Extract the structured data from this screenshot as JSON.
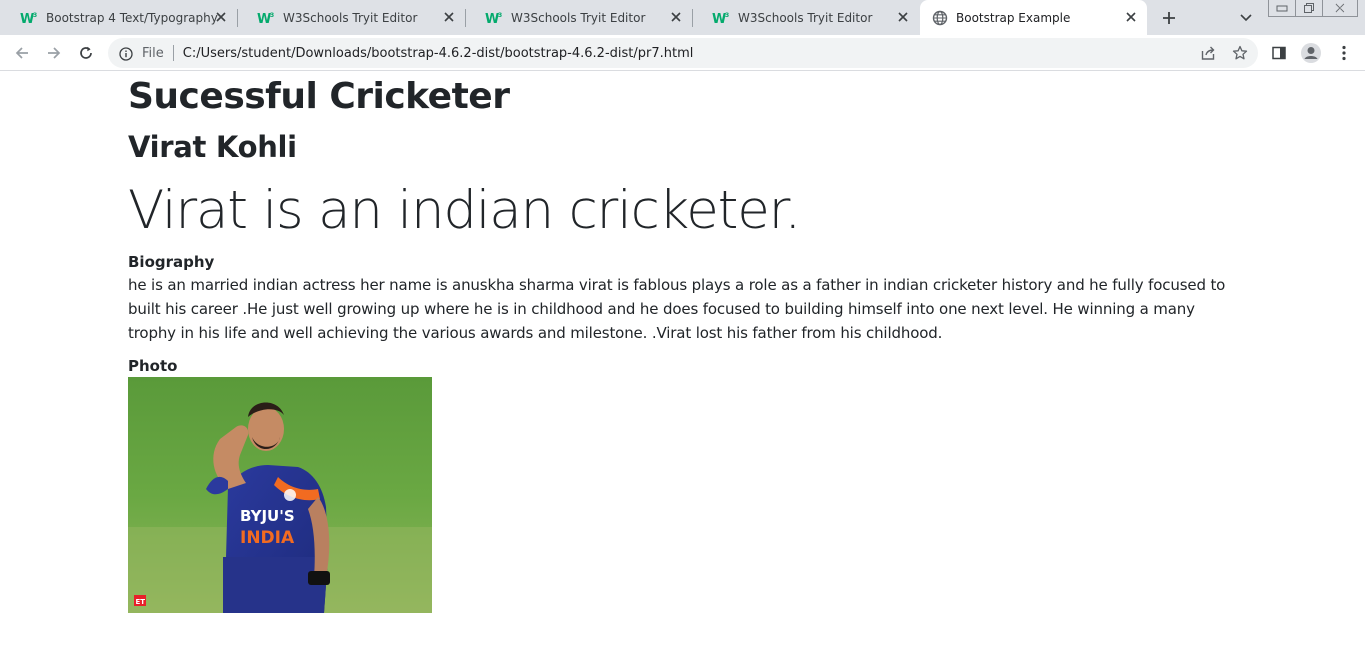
{
  "browser": {
    "tabs": [
      {
        "title": "Bootstrap 4 Text/Typography",
        "favicon": "w3schools-icon",
        "active": false
      },
      {
        "title": "W3Schools Tryit Editor",
        "favicon": "w3schools-icon",
        "active": false
      },
      {
        "title": "W3Schools Tryit Editor",
        "favicon": "w3schools-icon",
        "active": false
      },
      {
        "title": "W3Schools Tryit Editor",
        "favicon": "w3schools-icon",
        "active": false
      },
      {
        "title": "Bootstrap Example",
        "favicon": "globe-icon",
        "active": true
      }
    ],
    "address_bar": {
      "scheme_label": "File",
      "url": "C:/Users/student/Downloads/bootstrap-4.6.2-dist/bootstrap-4.6.2-dist/pr7.html"
    },
    "colors": {
      "tabstrip": "#dee1e6",
      "w3schools_green": "#04aa6d",
      "omnibox": "#f1f3f4"
    }
  },
  "page": {
    "title": "Sucessful Cricketer",
    "subtitle": "Virat Kohli",
    "lead": "Virat is an indian cricketer.",
    "biography_heading": "Biography",
    "biography_text": "he is an married indian actress her name is anuskha sharma virat is fablous plays a role as a father in indian cricketer history and he fully focused to built his career .He just well growing up where he is in childhood and he does focused to building himself into one next level. He winning a many trophy in his life and well achieving the various awards and milestone. .Virat lost his father from his childhood.",
    "photo_heading": "Photo",
    "photo_jersey_text": "BYJU'S INDIA",
    "photo_badge": "ET"
  }
}
